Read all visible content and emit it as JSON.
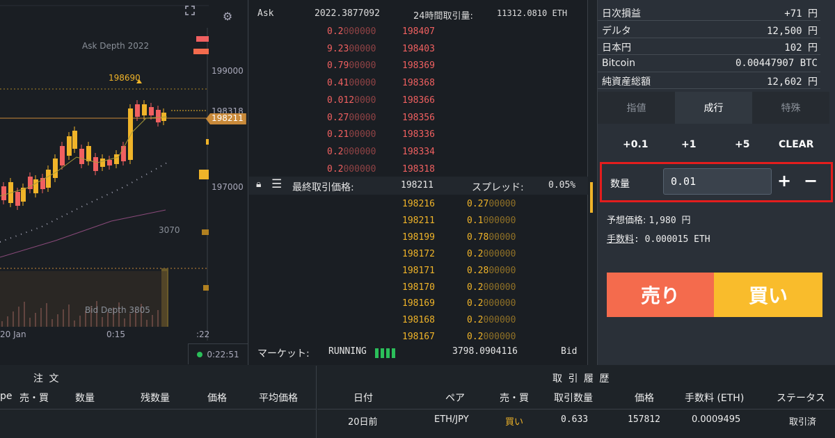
{
  "chart": {
    "ask_depth_label": "Ask Depth 2022",
    "bid_depth_label": "Bid Depth 3805",
    "marker_high": "198690",
    "price_label_1": "199000",
    "price_label_2": "198318",
    "price_label_current": "198211",
    "price_label_3": "197000",
    "volume_label": "3070",
    "time_label_1": "20 Jan",
    "time_label_2": "0:15",
    "time_label_3": ":22",
    "clock": "0:22:51",
    "expand_icon": "expand-icon",
    "settings_icon": "gear-icon"
  },
  "book": {
    "ask_label": "Ask",
    "ask_total": "2022.3877092",
    "volume_label": "24時間取引量:",
    "volume_value": "11312.0810 ETH",
    "asks": [
      {
        "amount_main": "0.2",
        "amount_dim": "000000",
        "price": "198407"
      },
      {
        "amount_main": "9.23",
        "amount_dim": "00000",
        "price": "198403"
      },
      {
        "amount_main": "0.79",
        "amount_dim": "00000",
        "price": "198369"
      },
      {
        "amount_main": "0.41",
        "amount_dim": "00000",
        "price": "198368"
      },
      {
        "amount_main": "0.012",
        "amount_dim": "0000",
        "price": "198366"
      },
      {
        "amount_main": "0.27",
        "amount_dim": "00000",
        "price": "198356"
      },
      {
        "amount_main": "0.21",
        "amount_dim": "00000",
        "price": "198336"
      },
      {
        "amount_main": "0.2",
        "amount_dim": "000000",
        "price": "198334"
      },
      {
        "amount_main": "0.2",
        "amount_dim": "000000",
        "price": "198318"
      }
    ],
    "last_price_label": "最終取引価格:",
    "last_price": "198211",
    "spread_label": "スプレッド:",
    "spread_value": "0.05%",
    "bids": [
      {
        "price": "198216",
        "amount_main": "0.27",
        "amount_dim": "00000"
      },
      {
        "price": "198211",
        "amount_main": "0.1",
        "amount_dim": "000000"
      },
      {
        "price": "198199",
        "amount_main": "0.78",
        "amount_dim": "00000"
      },
      {
        "price": "198172",
        "amount_main": "0.2",
        "amount_dim": "000000"
      },
      {
        "price": "198171",
        "amount_main": "0.28",
        "amount_dim": "00000"
      },
      {
        "price": "198170",
        "amount_main": "0.2",
        "amount_dim": "000000"
      },
      {
        "price": "198169",
        "amount_main": "0.2",
        "amount_dim": "000000"
      },
      {
        "price": "198168",
        "amount_main": "0.2",
        "amount_dim": "000000"
      },
      {
        "price": "198167",
        "amount_main": "0.2",
        "amount_dim": "000000"
      }
    ],
    "market_label": "マーケット:",
    "market_status": "RUNNING",
    "bid_total": "3798.0904116",
    "bid_label": "Bid"
  },
  "panel": {
    "balances": [
      {
        "key": "日次損益",
        "value": "+71 円"
      },
      {
        "key": "デルタ",
        "value": "12,500 円"
      },
      {
        "key": "日本円",
        "value": "102 円"
      },
      {
        "key": "Bitcoin",
        "value": "0.00447907 BTC"
      },
      {
        "key": "純資産総額",
        "value": "12,602 円"
      }
    ],
    "tabs": [
      "指値",
      "成行",
      "特殊"
    ],
    "active_tab": "成行",
    "quick": [
      "+0.1",
      "+1",
      "+5",
      "CLEAR"
    ],
    "qty_label": "数量",
    "qty_value": "0.01",
    "est_price_label": "予想価格:",
    "est_price_value": "1,980 円",
    "fee_label": "手数料",
    "fee_value": ": 0.000015 ETH",
    "sell_label": "売り",
    "buy_label": "買い"
  },
  "orders": {
    "title": "注 文",
    "headers": [
      "pe",
      "売・買",
      "数量",
      "残数量",
      "価格",
      "平均価格"
    ]
  },
  "history": {
    "title": "取 引 履 歴",
    "headers": [
      "日付",
      "ペア",
      "売・買",
      "取引数量",
      "価格",
      "手数料 (ETH)",
      "ステータス"
    ],
    "rows": [
      [
        "20日前",
        "ETH/JPY",
        "買い",
        "0.633",
        "157812",
        "0.0009495",
        "取引済"
      ]
    ]
  },
  "colors": {
    "ask": "#f06060",
    "bid": "#f0b429",
    "sell": "#f46b4d",
    "buy": "#f9bc2c",
    "highlight": "#e31d1d"
  }
}
